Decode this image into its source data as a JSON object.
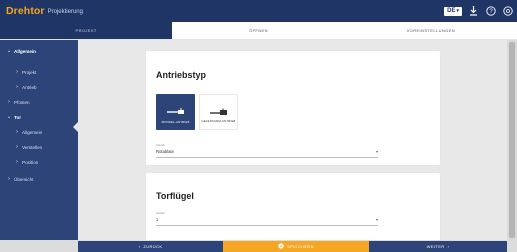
{
  "app": {
    "brand": "Drehtor",
    "subtitle": "Projektierung"
  },
  "topbar": {
    "language": "DE",
    "icons": [
      "download-icon",
      "help-icon",
      "info-icon"
    ]
  },
  "tabs": [
    {
      "label": "PROJEKT",
      "active": true
    },
    {
      "label": "ÖFFNEN",
      "active": false
    },
    {
      "label": "VOREINSTELLUNGEN",
      "active": false
    }
  ],
  "sidebar": {
    "items": [
      {
        "label": "Allgemein",
        "expanded": true
      },
      {
        "label": "Projekt"
      },
      {
        "label": "Antrieb"
      },
      {
        "label": "Pfosten"
      },
      {
        "label": "Tor",
        "expanded": true
      },
      {
        "label": "Allgemein"
      },
      {
        "label": "Verstellen"
      },
      {
        "label": "Position"
      },
      {
        "label": "Übersicht"
      }
    ]
  },
  "antriebstyp": {
    "title": "Antriebstyp",
    "options": [
      {
        "label": "SPINDEL-ANTRIEB",
        "selected": true
      },
      {
        "label": "GELENKARM-ANTRIEB",
        "selected": false
      }
    ],
    "field": {
      "label": "Antrieb",
      "value": "Rotablate"
    }
  },
  "torfluegel": {
    "title": "Torflügel",
    "field": {
      "label": "Anzahl",
      "value": "1"
    }
  },
  "footer": {
    "back": "ZURÜCK",
    "save": "SPEICHERN",
    "next": "WEITER"
  },
  "colors": {
    "navy": "#1f3566",
    "sidebar": "#2d4478",
    "accent": "#f5a623"
  }
}
